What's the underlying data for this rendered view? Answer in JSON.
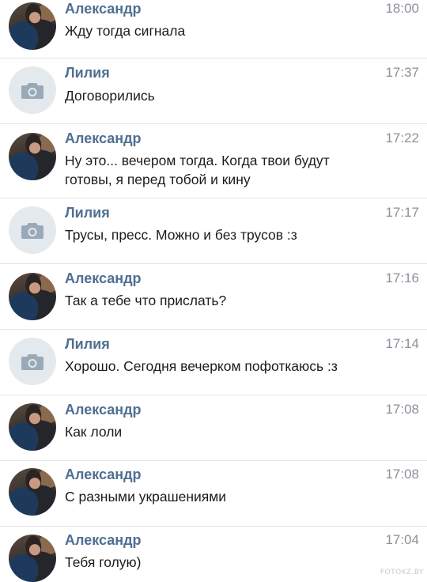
{
  "messages": [
    {
      "sender": "Александр",
      "time": "18:00",
      "text": "Жду тогда сигнала",
      "avatar": "photo"
    },
    {
      "sender": "Лилия",
      "time": "17:37",
      "text": "Договорились",
      "avatar": "placeholder"
    },
    {
      "sender": "Александр",
      "time": "17:22",
      "text": "Ну это... вечером тогда. Когда твои будут готовы, я перед тобой и кину",
      "avatar": "photo"
    },
    {
      "sender": "Лилия",
      "time": "17:17",
      "text": "Трусы, пресс. Можно и без трусов :з",
      "avatar": "placeholder"
    },
    {
      "sender": "Александр",
      "time": "17:16",
      "text": "Так а тебе что прислать?",
      "avatar": "photo"
    },
    {
      "sender": "Лилия",
      "time": "17:14",
      "text": "Хорошо. Сегодня вечерком пофоткаюсь :з",
      "avatar": "placeholder"
    },
    {
      "sender": "Александр",
      "time": "17:08",
      "text": "Как лоли",
      "avatar": "photo"
    },
    {
      "sender": "Александр",
      "time": "17:08",
      "text": "С разными украшениями",
      "avatar": "photo"
    },
    {
      "sender": "Александр",
      "time": "17:04",
      "text": "Тебя голую)",
      "avatar": "photo"
    }
  ],
  "watermark": "FOTOXZ.BY",
  "colors": {
    "sender_name": "#4f6f92",
    "time": "#8a9199",
    "text": "#1c1c1c",
    "divider": "#e3e6ea",
    "placeholder_avatar": "#e4e9ee",
    "camera_icon": "#9aa9b8"
  }
}
